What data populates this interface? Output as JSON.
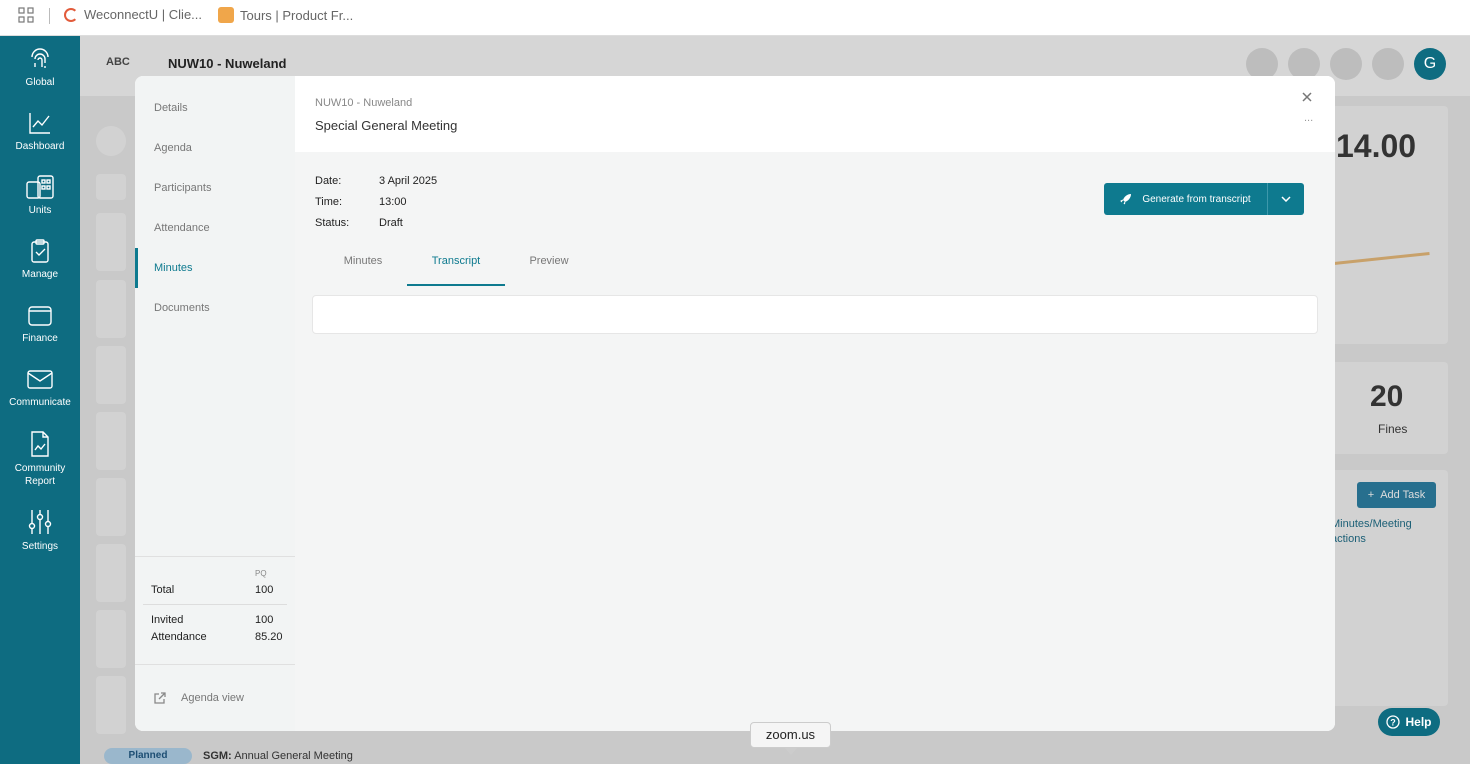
{
  "browser": {
    "bookmarks": [
      {
        "label": "WeconnectU | Clie...",
        "color": "#e25b3b"
      },
      {
        "label": "Tours | Product Fr...",
        "color": "#f0a64a"
      }
    ]
  },
  "nav": {
    "items": [
      {
        "label": "Global",
        "icon": "fingerprint-icon"
      },
      {
        "label": "Dashboard",
        "icon": "chart-icon"
      },
      {
        "label": "Units",
        "icon": "building-icon"
      },
      {
        "label": "Manage",
        "icon": "clipboard-check-icon"
      },
      {
        "label": "Finance",
        "icon": "wallet-icon"
      },
      {
        "label": "Communicate",
        "icon": "mail-icon"
      },
      {
        "label": "Community Report",
        "icon": "report-icon"
      },
      {
        "label": "Settings",
        "icon": "sliders-icon"
      }
    ]
  },
  "background": {
    "logo": "ABC",
    "title": "NUW10 - Nuweland",
    "avatar_letter": "G",
    "big_number": "14.00",
    "fines_count": "20",
    "fines_label": "Fines",
    "add_task": "Add Task",
    "link_line1": "Minutes/Meeting",
    "link_line2": "actions",
    "pill": "Planned",
    "sgm_prefix": "SGM:",
    "sgm_text": "Annual General Meeting",
    "help": "Help"
  },
  "modal": {
    "sidebar": [
      "Details",
      "Agenda",
      "Participants",
      "Attendance",
      "Minutes",
      "Documents"
    ],
    "active_section": "Minutes",
    "stats": {
      "column_header": "PQ",
      "total_label": "Total",
      "total_value": "100",
      "invited_label": "Invited",
      "invited_value": "100",
      "attendance_label": "Attendance",
      "attendance_value": "85.20"
    },
    "agenda_view": "Agenda view",
    "breadcrumb": "NUW10 - Nuweland",
    "title": "Special General Meeting",
    "more": "...",
    "fields": {
      "date_label": "Date:",
      "date_value": "3 April 2025",
      "time_label": "Time:",
      "time_value": "13:00",
      "status_label": "Status:",
      "status_value": "Draft"
    },
    "generate_button": "Generate from transcript",
    "tabs": [
      "Minutes",
      "Transcript",
      "Preview"
    ],
    "active_tab": "Transcript"
  },
  "zoom_tooltip": "zoom.us",
  "colors": {
    "primary": "#0e6c81",
    "accent": "#0e7a8f"
  }
}
